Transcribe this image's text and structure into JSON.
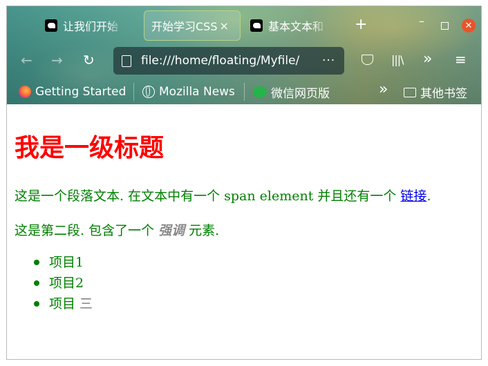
{
  "tabs": [
    {
      "title": "让我们开始"
    },
    {
      "title": "开始学习CSS",
      "close": "×"
    },
    {
      "title": "基本文本和"
    }
  ],
  "new_tab_symbol": "+",
  "window_controls": {
    "minimize": "–",
    "close": "✕"
  },
  "nav": {
    "back": "←",
    "forward": "→",
    "reload": "↻",
    "url": "file:///home/floating/Myfile/",
    "url_more": "···",
    "library": "|||\\",
    "overflow": "»",
    "menu": "≡"
  },
  "bookmarks": [
    {
      "label": "Getting Started",
      "icon": "firefox-icon"
    },
    {
      "label": "Mozilla News",
      "icon": "globe-icon"
    },
    {
      "label": "微信网页版",
      "icon": "wechat-icon"
    }
  ],
  "bookmarks_overflow": "»",
  "other_bookmarks": "其他书签",
  "page": {
    "heading": "我是一级标题",
    "p1_text": "这是一个段落文本. 在文本中有一个 span element 并且还有一个 ",
    "p1_link": "链接",
    "p1_end": ".",
    "p2_text": "这是第二段. 包含了一个 ",
    "p2_em": "强调",
    "p2_end": " 元素.",
    "list": [
      {
        "text": "项目1"
      },
      {
        "text": "项目2"
      },
      {
        "text": "项目 ",
        "muted": "三"
      }
    ]
  },
  "colors": {
    "heading": "#ff0000",
    "text": "#008000",
    "link": "#0000ee",
    "emphasis": "#8a8a8a",
    "close_button": "#e9542a"
  }
}
